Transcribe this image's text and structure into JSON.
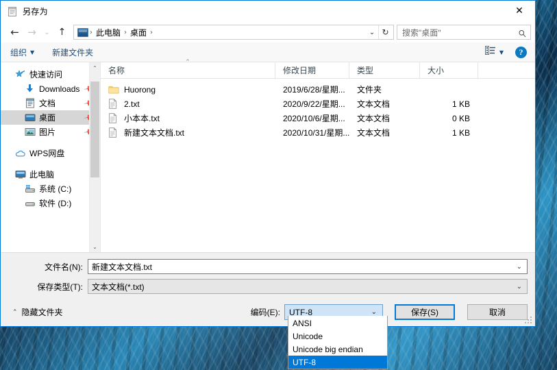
{
  "window": {
    "title": "另存为",
    "title_icon": "notepad-icon",
    "close_label": "✕"
  },
  "navbar": {
    "back_icon": "←",
    "forward_icon": "→",
    "history_icon": "⌄",
    "up_icon": "↑",
    "breadcrumbs": [
      "此电脑",
      "桌面"
    ],
    "crumb_sep": "›",
    "dropdown_icon": "⌄",
    "refresh_icon": "↻",
    "search_placeholder": "搜索\"桌面\""
  },
  "commandbar": {
    "organize_label": "组织",
    "organize_caret": "▼",
    "new_folder_label": "新建文件夹",
    "view_caret": "▼",
    "help_label": "?"
  },
  "sidebar": {
    "items": [
      {
        "label": "快速访问",
        "icon": "star-pin-icon",
        "indent": 0,
        "pinned": false,
        "selected": false
      },
      {
        "label": "Downloads",
        "icon": "download-icon",
        "indent": 1,
        "pinned": true,
        "selected": false
      },
      {
        "label": "文档",
        "icon": "documents-icon",
        "indent": 1,
        "pinned": true,
        "selected": false
      },
      {
        "label": "桌面",
        "icon": "desktop-icon",
        "indent": 1,
        "pinned": true,
        "selected": true
      },
      {
        "label": "图片",
        "icon": "pictures-icon",
        "indent": 1,
        "pinned": true,
        "selected": false
      },
      {
        "label": "WPS网盘",
        "icon": "cloud-icon",
        "indent": 0,
        "pinned": false,
        "selected": false
      },
      {
        "label": "此电脑",
        "icon": "this-pc-icon",
        "indent": 0,
        "pinned": false,
        "selected": false
      },
      {
        "label": "系统 (C:)",
        "icon": "windows-drive-icon",
        "indent": 1,
        "pinned": false,
        "selected": false
      },
      {
        "label": "软件 (D:)",
        "icon": "drive-icon",
        "indent": 1,
        "pinned": false,
        "selected": false
      }
    ],
    "scroll_up_icon": "⌃",
    "scroll_down_icon": "⌄"
  },
  "filelist": {
    "columns": [
      "名称",
      "修改日期",
      "类型",
      "大小"
    ],
    "sort_indicator": "⌃",
    "rows": [
      {
        "name": "Huorong",
        "icon": "folder-icon",
        "date": "2019/6/28/星期...",
        "type": "文件夹",
        "size": ""
      },
      {
        "name": "2.txt",
        "icon": "text-file-icon",
        "date": "2020/9/22/星期...",
        "type": "文本文档",
        "size": "1 KB"
      },
      {
        "name": "小本本.txt",
        "icon": "text-file-icon",
        "date": "2020/10/6/星期...",
        "type": "文本文档",
        "size": "0 KB"
      },
      {
        "name": "新建文本文档.txt",
        "icon": "text-file-icon",
        "date": "2020/10/31/星期...",
        "type": "文本文档",
        "size": "1 KB"
      }
    ]
  },
  "form": {
    "filename_label": "文件名(N):",
    "filename_value": "新建文本文档.txt",
    "filetype_label": "保存类型(T):",
    "filetype_value": "文本文档(*.txt)",
    "combo_caret": "⌄",
    "hide_folders_label": "隐藏文件夹",
    "hide_folders_caret": "⌃",
    "encoding_label": "编码(E):",
    "encoding_value": "UTF-8",
    "encoding_options": [
      "ANSI",
      "Unicode",
      "Unicode big endian",
      "UTF-8"
    ],
    "encoding_selected_index": 3,
    "save_label": "保存(S)",
    "cancel_label": "取消"
  },
  "colors": {
    "accent": "#0078d7",
    "selection": "#0078d7",
    "sidebar_selected": "#d6d6d6",
    "combo_highlight": "#cfe5f7"
  }
}
